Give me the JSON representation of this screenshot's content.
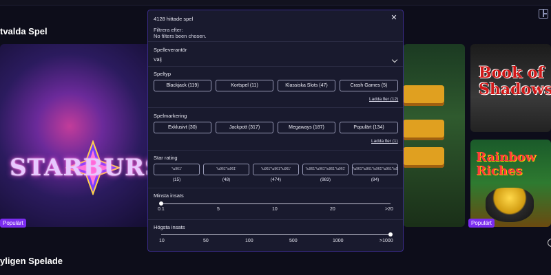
{
  "background": {
    "section_featured": "tvalda Spel",
    "section_recent": "yligen Spelade",
    "tile_starburst_text": "STARBURST",
    "tile_book_text": "Book of Shadows",
    "tile_rainbow_text": "Rainbow Riches",
    "badge_left": "Populärt",
    "badge_right": "Populärt"
  },
  "modal": {
    "title": "4128 hittade spel",
    "filter_label": "Filtrera efter:",
    "filter_value": "No filters been chosen.",
    "provider": {
      "label": "Spelleverantör",
      "value": "Välj"
    },
    "game_type": {
      "label": "Speltyp",
      "chips": [
        "Blackjack (119)",
        "Kortspel (11)",
        "Klassiska Slots (47)",
        "Crash Games (5)"
      ],
      "more": "Ladda fler (12)"
    },
    "marking": {
      "label": "Spelmarkering",
      "chips": [
        "Exklusivt (30)",
        "Jackpott (317)",
        "Megaways (187)",
        "Populärt (134)"
      ],
      "more": "Ladda fler (1)"
    },
    "rating": {
      "label": "Star rating",
      "chips": [
        "'\\u961'",
        "'\\u961''\\u961'",
        "'\\u961''\\u961''\\u961'",
        "'\\u961''\\u961''\\u961''\\u961'",
        "'\\u961''\\u961''\\u961''\\u961''\\u961'"
      ],
      "counts": [
        "(15)",
        "(48)",
        "(474)",
        "(983)",
        "(84)"
      ]
    },
    "min_bet": {
      "label": "Minsta insats",
      "ticks": [
        "0.1",
        "5",
        "10",
        "20",
        ">20"
      ],
      "value_fraction": 0
    },
    "max_bet": {
      "label": "Högsta insats",
      "ticks": [
        "10",
        "50",
        "100",
        "500",
        "1000",
        ">1000"
      ],
      "value_fraction": 1
    }
  },
  "colors": {
    "accent": "#7b2cf0",
    "modal_bg": "#191a2e",
    "modal_border": "#3a2c8a",
    "page_bg": "#0d0d1a"
  }
}
